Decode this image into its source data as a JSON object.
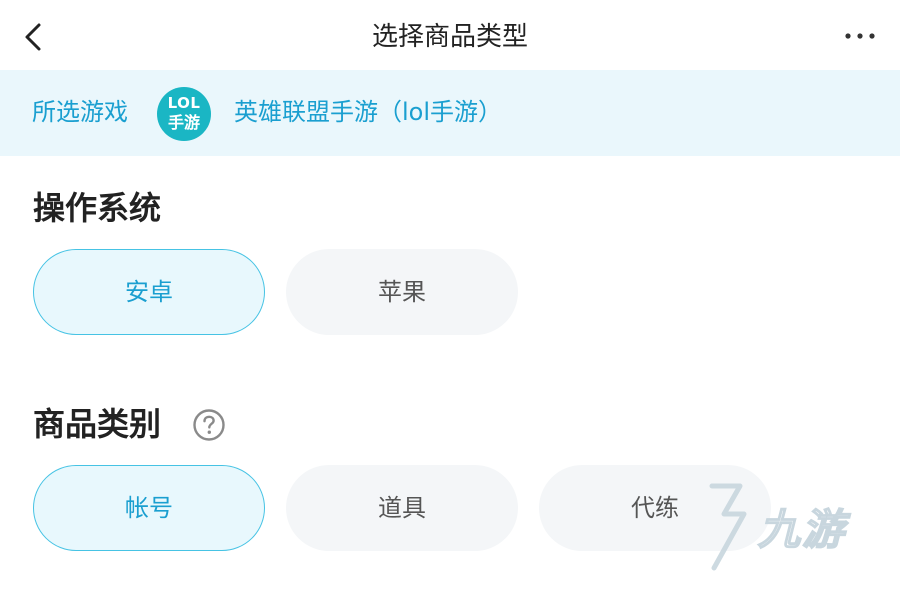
{
  "header": {
    "title": "选择商品类型",
    "back_icon": "chevron-left-icon",
    "more_icon": "more-horizontal-icon"
  },
  "selected_game": {
    "label": "所选游戏",
    "logo_line1": "LOL",
    "logo_line2": "手游",
    "name": "英雄联盟手游（lol手游）"
  },
  "os_section": {
    "title": "操作系统",
    "options": [
      {
        "label": "安卓",
        "selected": true
      },
      {
        "label": "苹果",
        "selected": false
      }
    ]
  },
  "category_section": {
    "title": "商品类别",
    "help_icon": "question-circle-icon",
    "options": [
      {
        "label": "帐号",
        "selected": true
      },
      {
        "label": "道具",
        "selected": false
      },
      {
        "label": "代练",
        "selected": false
      }
    ]
  },
  "watermark": {
    "text": "九游"
  },
  "colors": {
    "accent": "#1a9fd0",
    "accent_border": "#46c3e4",
    "strip_bg": "#eaf7fc",
    "chip_bg": "#f4f6f8",
    "logo_bg": "#1ab6c4"
  }
}
